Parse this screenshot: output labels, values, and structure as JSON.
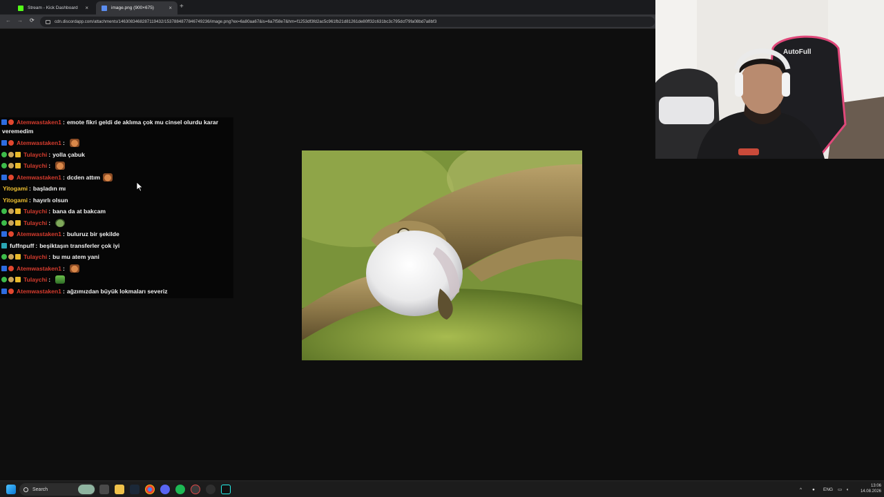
{
  "browser": {
    "tabs": [
      {
        "label": "Stream - Kick Dashboard",
        "favicon_color": "#53fc18"
      },
      {
        "label": "image.png (900×675)",
        "favicon_color": "#5b8def"
      }
    ],
    "new_tab_glyph": "+",
    "close_glyph": "×",
    "url": "cdn.discordapp.com/attachments/1463083468287119432/1537884877846749236/image.png?ex=6a80aa67&is=6a7f58e7&hm=f1253df3fd2ac5c961fb21d81261de80ff32c631bc3c795dcf79fa08bd7a8bf3",
    "nav": {
      "back": "←",
      "forward": "→",
      "reload": "⟳"
    }
  },
  "chat": {
    "first_wrapped": {
      "user": "Atemwastaken1",
      "text": "emote fikri geldi de aklıma çok mu cinsel olurdu karar",
      "continuation": "veremedim"
    },
    "messages": [
      {
        "badges": [
          "blue",
          "red"
        ],
        "user": "Atemwastaken1",
        "color": "red",
        "text": "",
        "emote": "cat"
      },
      {
        "badges": [
          "green",
          "tan",
          "gold"
        ],
        "user": "Tulaychi",
        "color": "red",
        "text": "yolla çabuk",
        "emote": ""
      },
      {
        "badges": [
          "green",
          "tan",
          "gold"
        ],
        "user": "Tulaychi",
        "color": "red",
        "text": "",
        "emote": "cat"
      },
      {
        "badges": [
          "blue",
          "red"
        ],
        "user": "Atemwastaken1",
        "color": "red",
        "text": "dcden attım",
        "emote": "cat"
      },
      {
        "badges": [],
        "user": "Yitogami",
        "color": "yellow",
        "text": "başladın mı",
        "emote": ""
      },
      {
        "badges": [],
        "user": "Yitogami",
        "color": "yellow",
        "text": "hayırlı olsun",
        "emote": ""
      },
      {
        "badges": [
          "green",
          "tan",
          "gold"
        ],
        "user": "Tulaychi",
        "color": "red",
        "text": "bana da at bakcam",
        "emote": ""
      },
      {
        "badges": [
          "green",
          "tan",
          "gold"
        ],
        "user": "Tulaychi",
        "color": "red",
        "text": "",
        "emote": "frog"
      },
      {
        "badges": [
          "blue",
          "red"
        ],
        "user": "Atemwastaken1",
        "color": "red",
        "text": "buluruz bir şekilde",
        "emote": ""
      },
      {
        "badges": [
          "teal"
        ],
        "user": "fuffnpuff",
        "color": "white",
        "text": "beşiktaşın transferler çok iyi",
        "emote": ""
      },
      {
        "badges": [
          "green",
          "tan",
          "gold"
        ],
        "user": "Tulaychi",
        "color": "red",
        "text": "bu mu atem yani",
        "emote": ""
      },
      {
        "badges": [
          "blue",
          "red"
        ],
        "user": "Atemwastaken1",
        "color": "red",
        "text": "",
        "emote": "cat"
      },
      {
        "badges": [
          "green",
          "tan",
          "gold"
        ],
        "user": "Tulaychi",
        "color": "red",
        "text": "",
        "emote": "pic"
      },
      {
        "badges": [
          "blue",
          "red"
        ],
        "user": "Atemwastaken1",
        "color": "red",
        "text": "ağzımızdan büyük lokmaları severiz",
        "emote": ""
      }
    ]
  },
  "webcam": {
    "chair_logo": "AutoFull"
  },
  "taskbar": {
    "search_label": "Search",
    "tray_lang": "ENG",
    "time": "13:06",
    "date": "14.08.2026"
  },
  "colors": {
    "username_red": "#d63c2e",
    "username_yellow": "#f1c232",
    "kick_green": "#53fc18"
  }
}
